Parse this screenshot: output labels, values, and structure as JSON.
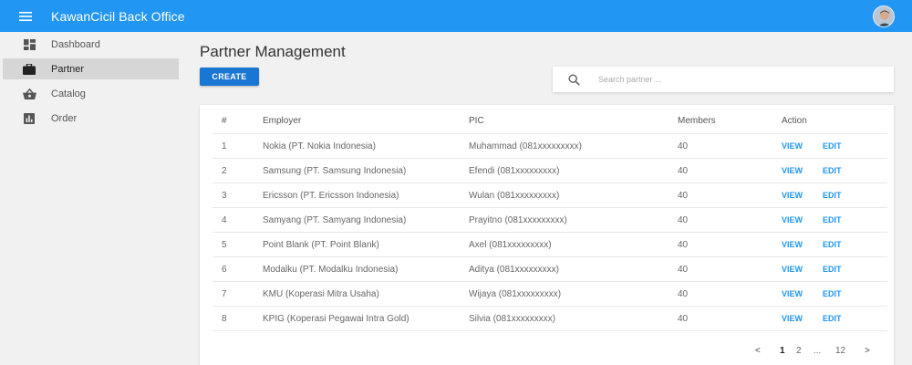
{
  "app": {
    "title": "KawanCicil Back Office"
  },
  "sidebar": {
    "items": [
      {
        "label": "Dashboard",
        "icon": "dashboard-icon",
        "active": false
      },
      {
        "label": "Partner",
        "icon": "briefcase-icon",
        "active": true
      },
      {
        "label": "Catalog",
        "icon": "basket-icon",
        "active": false
      },
      {
        "label": "Order",
        "icon": "bar-chart-icon",
        "active": false
      }
    ]
  },
  "main": {
    "title": "Partner Management",
    "create_label": "CREATE",
    "search": {
      "placeholder": "Search partner ...",
      "value": ""
    }
  },
  "table": {
    "headers": {
      "num": "#",
      "employer": "Employer",
      "pic": "PIC",
      "members": "Members",
      "action": "Action"
    },
    "rows": [
      {
        "num": "1",
        "employer": "Nokia (PT. Nokia Indonesia)",
        "pic": "Muhammad (081xxxxxxxxx)",
        "members": "40",
        "view": "VIEW",
        "edit": "EDIT"
      },
      {
        "num": "2",
        "employer": "Samsung (PT. Samsung Indonesia)",
        "pic": "Efendi (081xxxxxxxxx)",
        "members": "40",
        "view": "VIEW",
        "edit": "EDIT"
      },
      {
        "num": "3",
        "employer": "Ericsson (PT. Ericsson Indonesia)",
        "pic": "Wulan (081xxxxxxxxx)",
        "members": "40",
        "view": "VIEW",
        "edit": "EDIT"
      },
      {
        "num": "4",
        "employer": "Samyang (PT. Samyang Indonesia)",
        "pic": "Prayitno (081xxxxxxxxx)",
        "members": "40",
        "view": "VIEW",
        "edit": "EDIT"
      },
      {
        "num": "5",
        "employer": "Point Blank (PT. Point Blank)",
        "pic": "Axel (081xxxxxxxxx)",
        "members": "40",
        "view": "VIEW",
        "edit": "EDIT"
      },
      {
        "num": "6",
        "employer": "Modalku (PT. Modalku Indonesia)",
        "pic": "Aditya (081xxxxxxxxx)",
        "members": "40",
        "view": "VIEW",
        "edit": "EDIT"
      },
      {
        "num": "7",
        "employer": "KMU (Koperasi Mitra Usaha)",
        "pic": "Wijaya (081xxxxxxxxx)",
        "members": "40",
        "view": "VIEW",
        "edit": "EDIT"
      },
      {
        "num": "8",
        "employer": "KPIG (Koperasi Pegawai Intra Gold)",
        "pic": "Silvia (081xxxxxxxxx)",
        "members": "40",
        "view": "VIEW",
        "edit": "EDIT"
      }
    ]
  },
  "pagination": {
    "prev": "<",
    "pages": [
      "1",
      "2",
      "...",
      "12"
    ],
    "current": "1",
    "next": ">"
  },
  "colors": {
    "appbar": "#2196f3",
    "primary_button": "#1976d2",
    "link": "#2196f3",
    "active_sidebar": "#d6d6d6"
  }
}
